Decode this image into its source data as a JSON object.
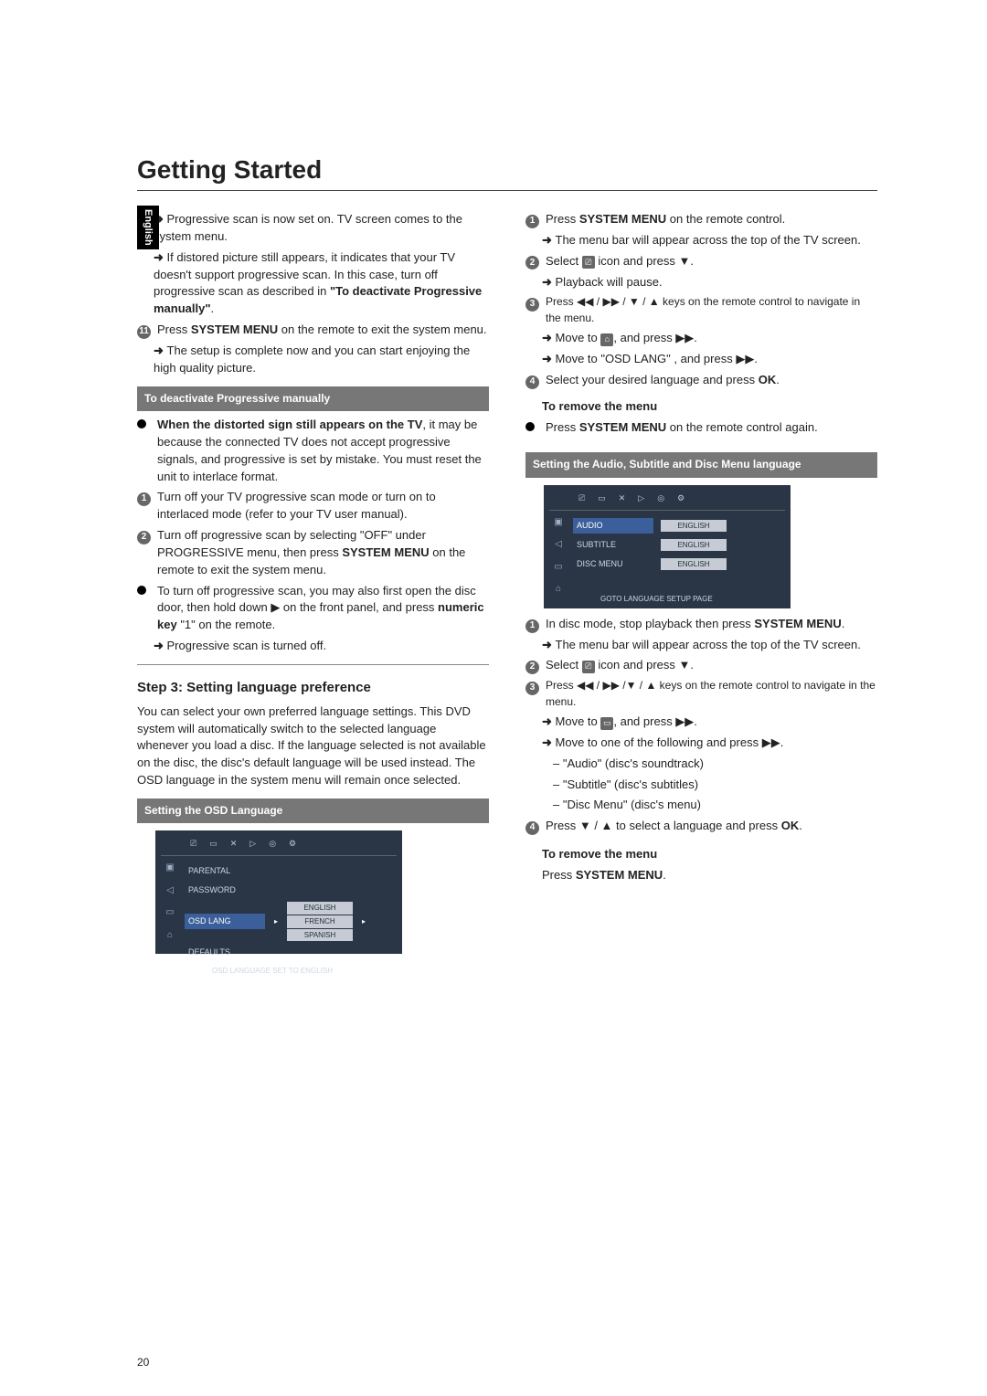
{
  "lang_tab": "English",
  "title": "Getting Started",
  "col1": {
    "p1": "Progressive scan is now set on. TV screen comes to the system menu.",
    "p2": "If distored picture still appears, it indicates that your TV doesn't support progressive scan. In this case, turn off progressive scan as described in ",
    "p2b": "\"To deactivate Progressive manually\"",
    "p2c": ".",
    "step11a": "Press ",
    "step11b": "SYSTEM MENU",
    "step11c": " on the remote to exit the system menu.",
    "p3": "The setup is complete now and you can start enjoying the high quality picture.",
    "bar1": "To deactivate Progressive manually",
    "note1a": "When the distorted sign still appears on the TV",
    "note1b": ", it may be because the connected TV does not accept progressive signals, and progressive is set by mistake. You must reset the unit to interlace format.",
    "s1": "Turn off your TV progressive scan mode or turn on to interlaced mode (refer to your TV user manual).",
    "s2a": "Turn off progressive scan by selecting \"OFF\" under PROGRESSIVE menu, then press ",
    "s2b": "SYSTEM MENU",
    "s2c": " on the remote to exit the system menu.",
    "s3a": "To turn off progressive scan, you may also first open the disc door, then hold down ▶ on the front panel, and press ",
    "s3b": "numeric key",
    "s3c": " \"1\" on the remote.",
    "p4": "Progressive scan is turned off.",
    "step3title": "Step 3:    Setting language preference",
    "p5": "You can select your own preferred language settings. This DVD system will automatically switch to the selected language whenever you load a disc. If the language selected is not available on the disc, the disc's default language will be used instead. The OSD language in the system menu will remain once selected.",
    "bar2": "Setting the OSD Language",
    "osd1": {
      "rows": [
        {
          "label": "PARENTAL"
        },
        {
          "label": "PASSWORD"
        },
        {
          "label": "OSD LANG",
          "hl": true,
          "opts": [
            "ENGLISH",
            "FRENCH",
            "SPANISH"
          ]
        },
        {
          "label": "DEFAULTS"
        }
      ],
      "status": "OSD LANGUAGE SET TO ENGLISH"
    }
  },
  "col2": {
    "s1a": "Press ",
    "s1b": "SYSTEM MENU",
    "s1c": " on the remote control.",
    "s1d": "The menu bar will appear across the top of the TV screen.",
    "s2a": "Select ",
    "s2b": " icon and press ▼.",
    "s2c": "Playback will pause.",
    "s3a": "Press ◀◀ / ▶▶  /  ▼  /  ▲  keys on the remote control to navigate in the menu.",
    "s3b": "Move to ",
    "s3c": ", and press ▶▶.",
    "s3d": "Move to \"OSD LANG\" , and press ▶▶.",
    "s4a": "Select your desired language and press ",
    "s4b": "OK",
    "s4c": ".",
    "rem_h": "To remove the menu",
    "rem_a": "Press ",
    "rem_b": "SYSTEM MENU",
    "rem_c": " on the remote control again.",
    "bar3": "Setting the Audio,  Subtitle and Disc Menu language",
    "osd2": {
      "rows": [
        {
          "label": "AUDIO",
          "pill": "ENGLISH",
          "hl": true
        },
        {
          "label": "SUBTITLE",
          "pill": "ENGLISH"
        },
        {
          "label": "DISC MENU",
          "pill": "ENGLISH"
        }
      ],
      "status": "GOTO LANGUAGE SETUP PAGE"
    },
    "t1a": "In disc mode, stop playback then press ",
    "t1b": "SYSTEM MENU",
    "t1c": ".",
    "t1d": "The menu bar will appear across the top of the TV screen.",
    "t2a": "Select ",
    "t2b": " icon and press ▼.",
    "t3a": "Press ◀◀ / ▶▶  /▼  /  ▲  keys on the remote control to navigate in the menu.",
    "t3b": "Move to ",
    "t3c": ", and press ▶▶.",
    "t3d": "Move to one of the following and press ▶▶.",
    "opt1": "\"Audio\" (disc's soundtrack)",
    "opt2": "\"Subtitle\" (disc's subtitles)",
    "opt3": "\"Disc Menu\" (disc's menu)",
    "t4a": "Press ▼  /  ▲  to select a language and press ",
    "t4b": "OK",
    "t4c": ".",
    "rem2_h": "To remove the menu",
    "rem2_a": "Press ",
    "rem2_b": "SYSTEM MENU",
    "rem2_c": "."
  },
  "pagenum": "20"
}
